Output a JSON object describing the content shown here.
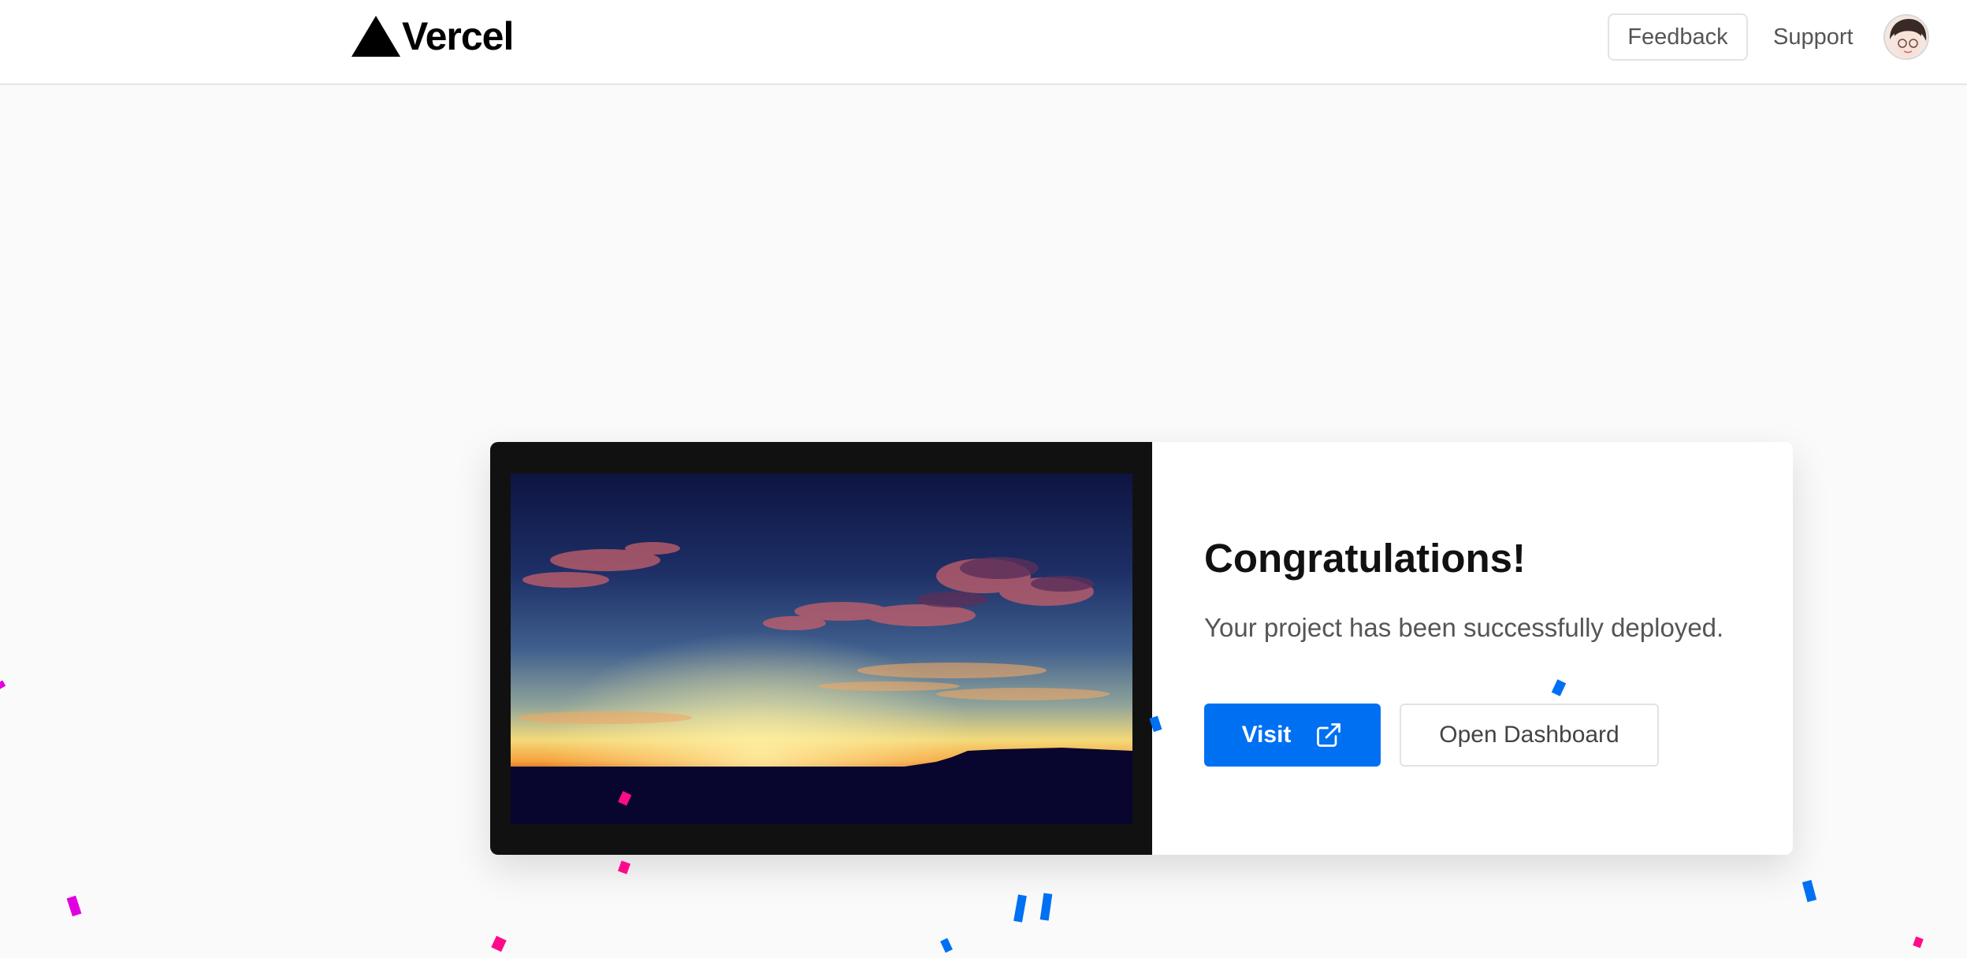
{
  "header": {
    "logo_text": "Vercel",
    "feedback_label": "Feedback",
    "support_label": "Support"
  },
  "card": {
    "title": "Congratulations!",
    "subtitle": "Your project has been successfully deployed.",
    "visit_label": "Visit",
    "dashboard_label": "Open Dashboard"
  },
  "colors": {
    "accent": "#0070f3",
    "confetti_pink": "#ff0a8a",
    "confetti_magenta": "#e000e0",
    "confetti_blue": "#0070f3"
  }
}
